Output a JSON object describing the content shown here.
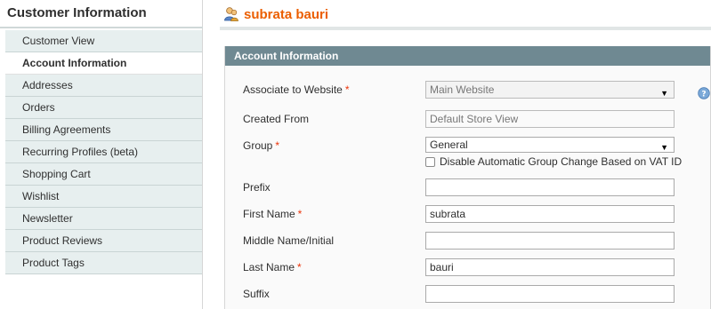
{
  "sidebar": {
    "title": "Customer Information",
    "items": [
      {
        "label": "Customer View",
        "active": false
      },
      {
        "label": "Account Information",
        "active": true
      },
      {
        "label": "Addresses",
        "active": false
      },
      {
        "label": "Orders",
        "active": false
      },
      {
        "label": "Billing Agreements",
        "active": false
      },
      {
        "label": "Recurring Profiles (beta)",
        "active": false
      },
      {
        "label": "Shopping Cart",
        "active": false
      },
      {
        "label": "Wishlist",
        "active": false
      },
      {
        "label": "Newsletter",
        "active": false
      },
      {
        "label": "Product Reviews",
        "active": false
      },
      {
        "label": "Product Tags",
        "active": false
      }
    ]
  },
  "header": {
    "title": "subrata bauri",
    "icon": "customer-icon"
  },
  "section": {
    "title": "Account Information"
  },
  "form": {
    "website": {
      "label": "Associate to Website",
      "required_mark": "*",
      "value": "Main Website"
    },
    "created_from": {
      "label": "Created From",
      "value": "Default Store View"
    },
    "group": {
      "label": "Group",
      "required_mark": "*",
      "value": "General",
      "checkbox_label": "Disable Automatic Group Change Based on VAT ID"
    },
    "prefix": {
      "label": "Prefix",
      "value": ""
    },
    "first_name": {
      "label": "First Name",
      "required_mark": "*",
      "value": "subrata"
    },
    "middle_name": {
      "label": "Middle Name/Initial",
      "value": ""
    },
    "last_name": {
      "label": "Last Name",
      "required_mark": "*",
      "value": "bauri"
    },
    "suffix": {
      "label": "Suffix",
      "value": ""
    }
  },
  "colors": {
    "title_orange": "#eb5e00",
    "section_header": "#6f8992",
    "sidebar_item_bg": "#e7efef",
    "required": "#eb340a"
  }
}
